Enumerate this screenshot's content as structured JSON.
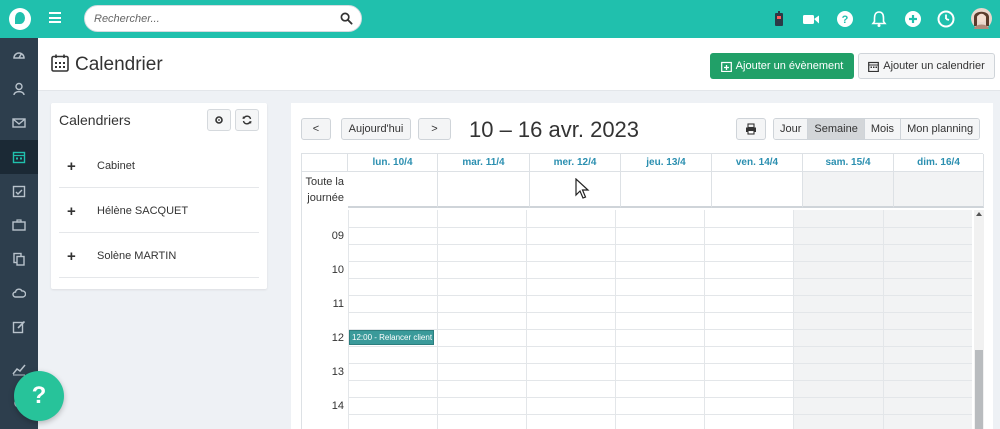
{
  "search": {
    "placeholder": "Rechercher..."
  },
  "header": {
    "title": "Calendrier",
    "add_event_label": "Ajouter un évènement",
    "add_calendar_label": "Ajouter un calendrier"
  },
  "calendars_panel": {
    "title": "Calendriers",
    "items": [
      {
        "label": "Cabinet"
      },
      {
        "label": "Hélène SACQUET"
      },
      {
        "label": "Solène MARTIN"
      }
    ]
  },
  "calendar": {
    "today_label": "Aujourd'hui",
    "prev_label": "<",
    "next_label": ">",
    "range_title": "10 – 16 avr. 2023",
    "views": [
      "Jour",
      "Semaine",
      "Mois",
      "Mon planning"
    ],
    "active_view": "Semaine",
    "all_day_label": "Toute la journée",
    "days": [
      "lun. 10/4",
      "mar. 11/4",
      "mer. 12/4",
      "jeu. 13/4",
      "ven. 14/4",
      "sam. 15/4",
      "dim. 16/4"
    ],
    "hours": [
      "09",
      "10",
      "11",
      "12",
      "13",
      "14"
    ],
    "event": {
      "label": "12:00 - Relancer client",
      "day": "lun. 10/4",
      "start": "12:00"
    }
  },
  "help": {
    "label": "?"
  },
  "colors": {
    "topbar": "#20c0ad",
    "sidebar": "#2d3e4d",
    "primary_button": "#21a068",
    "day_header_text": "#2b8fb0",
    "event": "#3a9a9a",
    "help_button": "#27c39a"
  },
  "icons": {
    "topbar": [
      "logo-icon",
      "menu-icon",
      "search-icon",
      "contact-card-icon",
      "video-icon",
      "help-icon",
      "bell-icon",
      "plus-icon",
      "clock-icon",
      "avatar"
    ],
    "sidebar": [
      "dashboard-icon",
      "patients-icon",
      "mail-icon",
      "calendar-icon",
      "tasks-icon",
      "briefcase-icon",
      "documents-icon",
      "cloud-icon",
      "edit-icon",
      "chart-icon",
      "settings-icon"
    ]
  }
}
